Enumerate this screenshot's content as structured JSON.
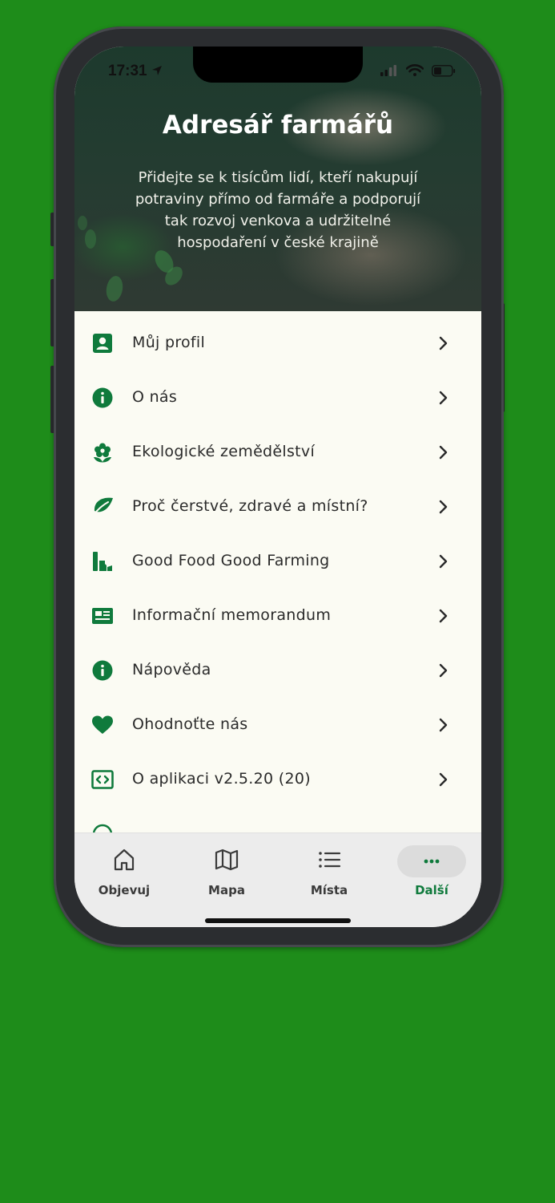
{
  "status_bar": {
    "time": "17:31"
  },
  "hero": {
    "title": "Adresář farmářů",
    "subtitle_lines": [
      "Přidejte se k tisícům lidí, kteří nakupují",
      "potraviny přímo od farmáře a podporují",
      "tak rozvoj venkova a udržitelné",
      "hospodaření v české krajině"
    ]
  },
  "menu": {
    "items": [
      {
        "label": "Můj profil",
        "icon": "profile-card-icon"
      },
      {
        "label": "O nás",
        "icon": "info-icon"
      },
      {
        "label": "Ekologické zemědělství",
        "icon": "flower-icon"
      },
      {
        "label": "Proč čerstvé, zdravé a místní?",
        "icon": "leaf-icon"
      },
      {
        "label": "Good Food Good Farming",
        "icon": "bottle-icon"
      },
      {
        "label": "Informační memorandum",
        "icon": "newspaper-icon"
      },
      {
        "label": "Nápověda",
        "icon": "info-icon"
      },
      {
        "label": "Ohodnoťte nás",
        "icon": "heart-icon"
      },
      {
        "label": "O aplikaci v2.5.20 (20)",
        "icon": "code-icon"
      }
    ]
  },
  "tabbar": {
    "tabs": [
      {
        "label": "Objevuj",
        "icon": "home-icon",
        "active": false
      },
      {
        "label": "Mapa",
        "icon": "map-icon",
        "active": false
      },
      {
        "label": "Místa",
        "icon": "list-icon",
        "active": false
      },
      {
        "label": "Další",
        "icon": "more-icon",
        "active": true
      }
    ]
  },
  "colors": {
    "background": "#1e8c1a",
    "accent": "#0f7a3c",
    "screen": "#fbfbf3"
  }
}
